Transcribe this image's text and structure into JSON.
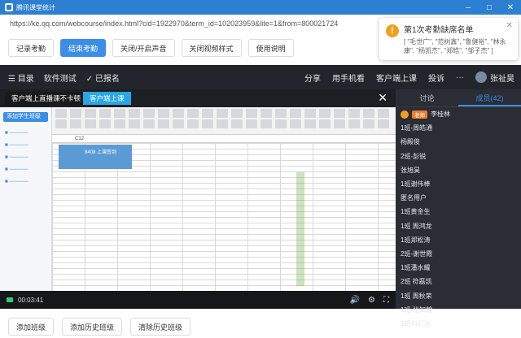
{
  "window": {
    "title": "腾讯课堂统计",
    "controls": [
      "–",
      "□",
      "✕"
    ]
  },
  "url": "https://ke.qq.com/webcourse/index.html?cid=1922970&term_id=102023959&lite=1&from=800021724",
  "toolbar": [
    "记录考勤",
    "结束考勤",
    "关闭/开启声音",
    "关闭视频样式",
    "使用说明"
  ],
  "toolbar_active_index": 1,
  "notification": {
    "title": "第1次考勤缺席名单",
    "body": "[ \"毛世广\", \"范树鑫\", \"鲁健裕\", \"林永康\", \"杨凯杰\", \"郑皓\", \"邹子杰\" ]",
    "icon": "exclamation-icon"
  },
  "classroom": {
    "nav_left": [
      "☰ 目录",
      "软件测试",
      "✓ 已报名"
    ],
    "nav_right": [
      "分享",
      "用手机看",
      "客户端上课",
      "投诉",
      "···",
      "张祉昊"
    ]
  },
  "video": {
    "tab1": "客户端上直播课不卡顿",
    "tab2": "客户端上课",
    "time": "00:03:41",
    "sheet_title": "8408 上课签到",
    "cell_ref": "C12",
    "left_button": "添加学生班级"
  },
  "side": {
    "tabs": [
      "讨论",
      "成员(42)"
    ],
    "active_tab": 1,
    "members": [
      {
        "badge": "老师",
        "name": "李桂林"
      },
      {
        "badge": "",
        "name": "1班-周皓通"
      },
      {
        "badge": "",
        "name": "杨殿俊"
      },
      {
        "badge": "",
        "name": "2班-彭锐"
      },
      {
        "badge": "",
        "name": "张旭昊"
      },
      {
        "badge": "",
        "name": "1班谢伟棒"
      },
      {
        "badge": "",
        "name": "匿名用户"
      },
      {
        "badge": "",
        "name": "1班黄金生"
      },
      {
        "badge": "",
        "name": "1班 周鸿龙"
      },
      {
        "badge": "",
        "name": "1班郑松涛"
      },
      {
        "badge": "",
        "name": "2班-谢世霞"
      },
      {
        "badge": "",
        "name": "1班潘水耀"
      },
      {
        "badge": "",
        "name": "2班 符磊凯"
      },
      {
        "badge": "",
        "name": "1班 周秋荣"
      },
      {
        "badge": "",
        "name": "1班-张知翰"
      },
      {
        "badge": "",
        "name": "1班何汇治"
      }
    ]
  },
  "bottom": [
    "添加班级",
    "添加历史班级",
    "清除历史班级"
  ]
}
